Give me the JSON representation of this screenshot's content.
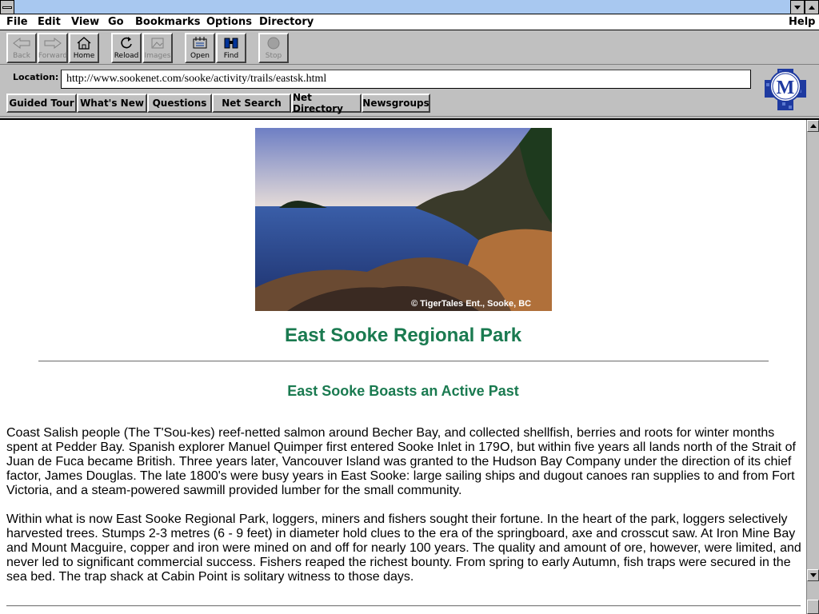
{
  "menu": {
    "file": "File",
    "edit": "Edit",
    "view": "View",
    "go": "Go",
    "bookmarks": "Bookmarks",
    "options": "Options",
    "directory": "Directory",
    "help": "Help"
  },
  "toolbar": {
    "back": "Back",
    "forward": "Forward",
    "home": "Home",
    "reload": "Reload",
    "images": "Images",
    "open": "Open",
    "find": "Find",
    "stop": "Stop"
  },
  "location": {
    "label": "Location:",
    "url": "http://www.sookenet.com/sooke/activity/trails/eastsk.html"
  },
  "directory_buttons": {
    "guided_tour": "Guided Tour",
    "whats_new": "What's New",
    "questions": "Questions",
    "net_search": "Net Search",
    "net_directory": "Net Directory",
    "newsgroups": "Newsgroups"
  },
  "logo": {
    "letter": "M"
  },
  "page": {
    "photo_credit": "© TigerTales Ent., Sooke, BC",
    "title": "East Sooke Regional Park",
    "subtitle": "East Sooke Boasts an Active Past",
    "para1": "Coast Salish people (The T'Sou-kes) reef-netted salmon around Becher Bay, and collected shellfish, berries and roots for winter months spent at Pedder Bay. Spanish explorer Manuel Quimper first entered Sooke Inlet in 179O, but within five years all lands north of the Strait of Juan de Fuca became British. Three years later, Vancouver Island was granted to the Hudson Bay Company under the direction of its chief factor, James Douglas. The late 1800's were busy years in East Sooke: large sailing ships and dugout canoes ran supplies to and from Fort Victoria, and a steam-powered sawmill provided lumber for the small community.",
    "para2": "Within what is now East Sooke Regional Park, loggers, miners and fishers sought their fortune. In the heart of the park, loggers selectively harvested trees. Stumps 2-3 metres (6 - 9 feet) in diameter hold clues to the era of the springboard, axe and crosscut saw. At Iron Mine Bay and Mount Macguire, copper and iron were mined on and off for nearly 100 years. The quality and amount of ore, however, were limited, and never led to significant commercial success. Fishers reaped the richest bounty. From spring to early Autumn, fish traps were secured in the sea bed. The trap shack at Cabin Point is solitary witness to those days."
  },
  "colors": {
    "heading": "#1a7a50",
    "titlebar": "#a8c8f0"
  }
}
